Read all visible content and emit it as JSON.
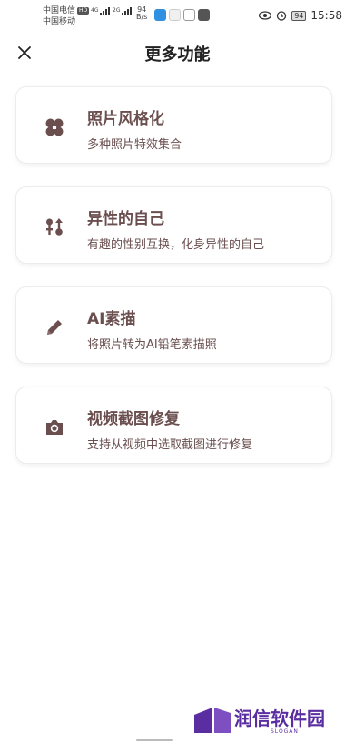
{
  "status_bar": {
    "carrier_1": "中国电信",
    "carrier_1_badge": "HD",
    "carrier_2": "中国移动",
    "signal_1_label": "4G",
    "signal_2_label": "2G",
    "net_rate_value": "94",
    "net_rate_unit": "B/s",
    "battery": "94",
    "time": "15:58"
  },
  "header": {
    "title": "更多功能"
  },
  "features": [
    {
      "title": "照片风格化",
      "desc": "多种照片特效集合",
      "icon": "clover-icon"
    },
    {
      "title": "异性的自己",
      "desc": "有趣的性别互换，化身异性的自己",
      "icon": "gender-swap-icon"
    },
    {
      "title": "AI素描",
      "desc": "将照片转为AI铅笔素描照",
      "icon": "pencil-icon"
    },
    {
      "title": "视频截图修复",
      "desc": "支持从视频中选取截图进行修复",
      "icon": "camera-icon"
    }
  ],
  "watermark": {
    "name": "润信软件园",
    "slogan": "SLOGAN"
  },
  "colors": {
    "accent": "#6b4f4f",
    "title": "#222222",
    "card_border": "#ececec",
    "watermark": "#5a2ea0"
  }
}
